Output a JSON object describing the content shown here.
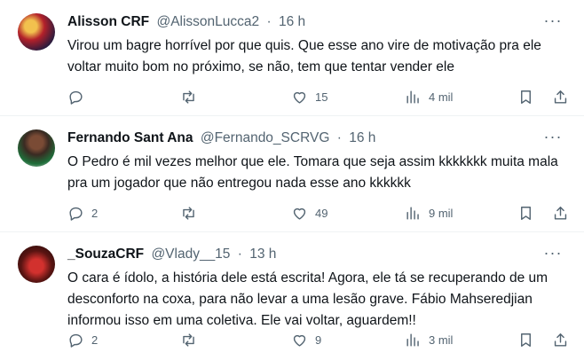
{
  "tweets": [
    {
      "name": "Alisson CRF",
      "handle": "@AlissonLucca2",
      "sep": "·",
      "time": "16 h",
      "text": "Virou um bagre horrível por que quis. Que esse ano vire de motivação pra ele voltar muito bom no próximo, se não, tem que tentar vender ele",
      "replies": "",
      "retweets": "",
      "likes": "15",
      "views": "4 mil"
    },
    {
      "name": "Fernando Sant Ana",
      "handle": "@Fernando_SCRVG",
      "sep": "·",
      "time": "16 h",
      "text": "O Pedro é mil vezes melhor que ele. Tomara que seja assim kkkkkkk muita mala pra um jogador que não entregou nada esse ano kkkkkk",
      "replies": "2",
      "retweets": "",
      "likes": "49",
      "views": "9 mil"
    },
    {
      "name": "_SouzaCRF",
      "handle": "@Vlady__15",
      "sep": "·",
      "time": "13 h",
      "text": "O cara é ídolo, a história dele está escrita! Agora, ele tá se recuperando de um desconforto na coxa, para não levar a uma lesão grave. Fábio Mahseredjian informou isso em uma coletiva. Ele vai voltar, aguardem!!",
      "replies": "2",
      "retweets": "",
      "likes": "9",
      "views": "3 mil"
    }
  ],
  "icons": {
    "more": "more-icon",
    "reply": "reply-icon",
    "retweet": "retweet-icon",
    "like": "heart-icon",
    "views": "views-icon",
    "bookmark": "bookmark-icon",
    "share": "share-icon"
  }
}
